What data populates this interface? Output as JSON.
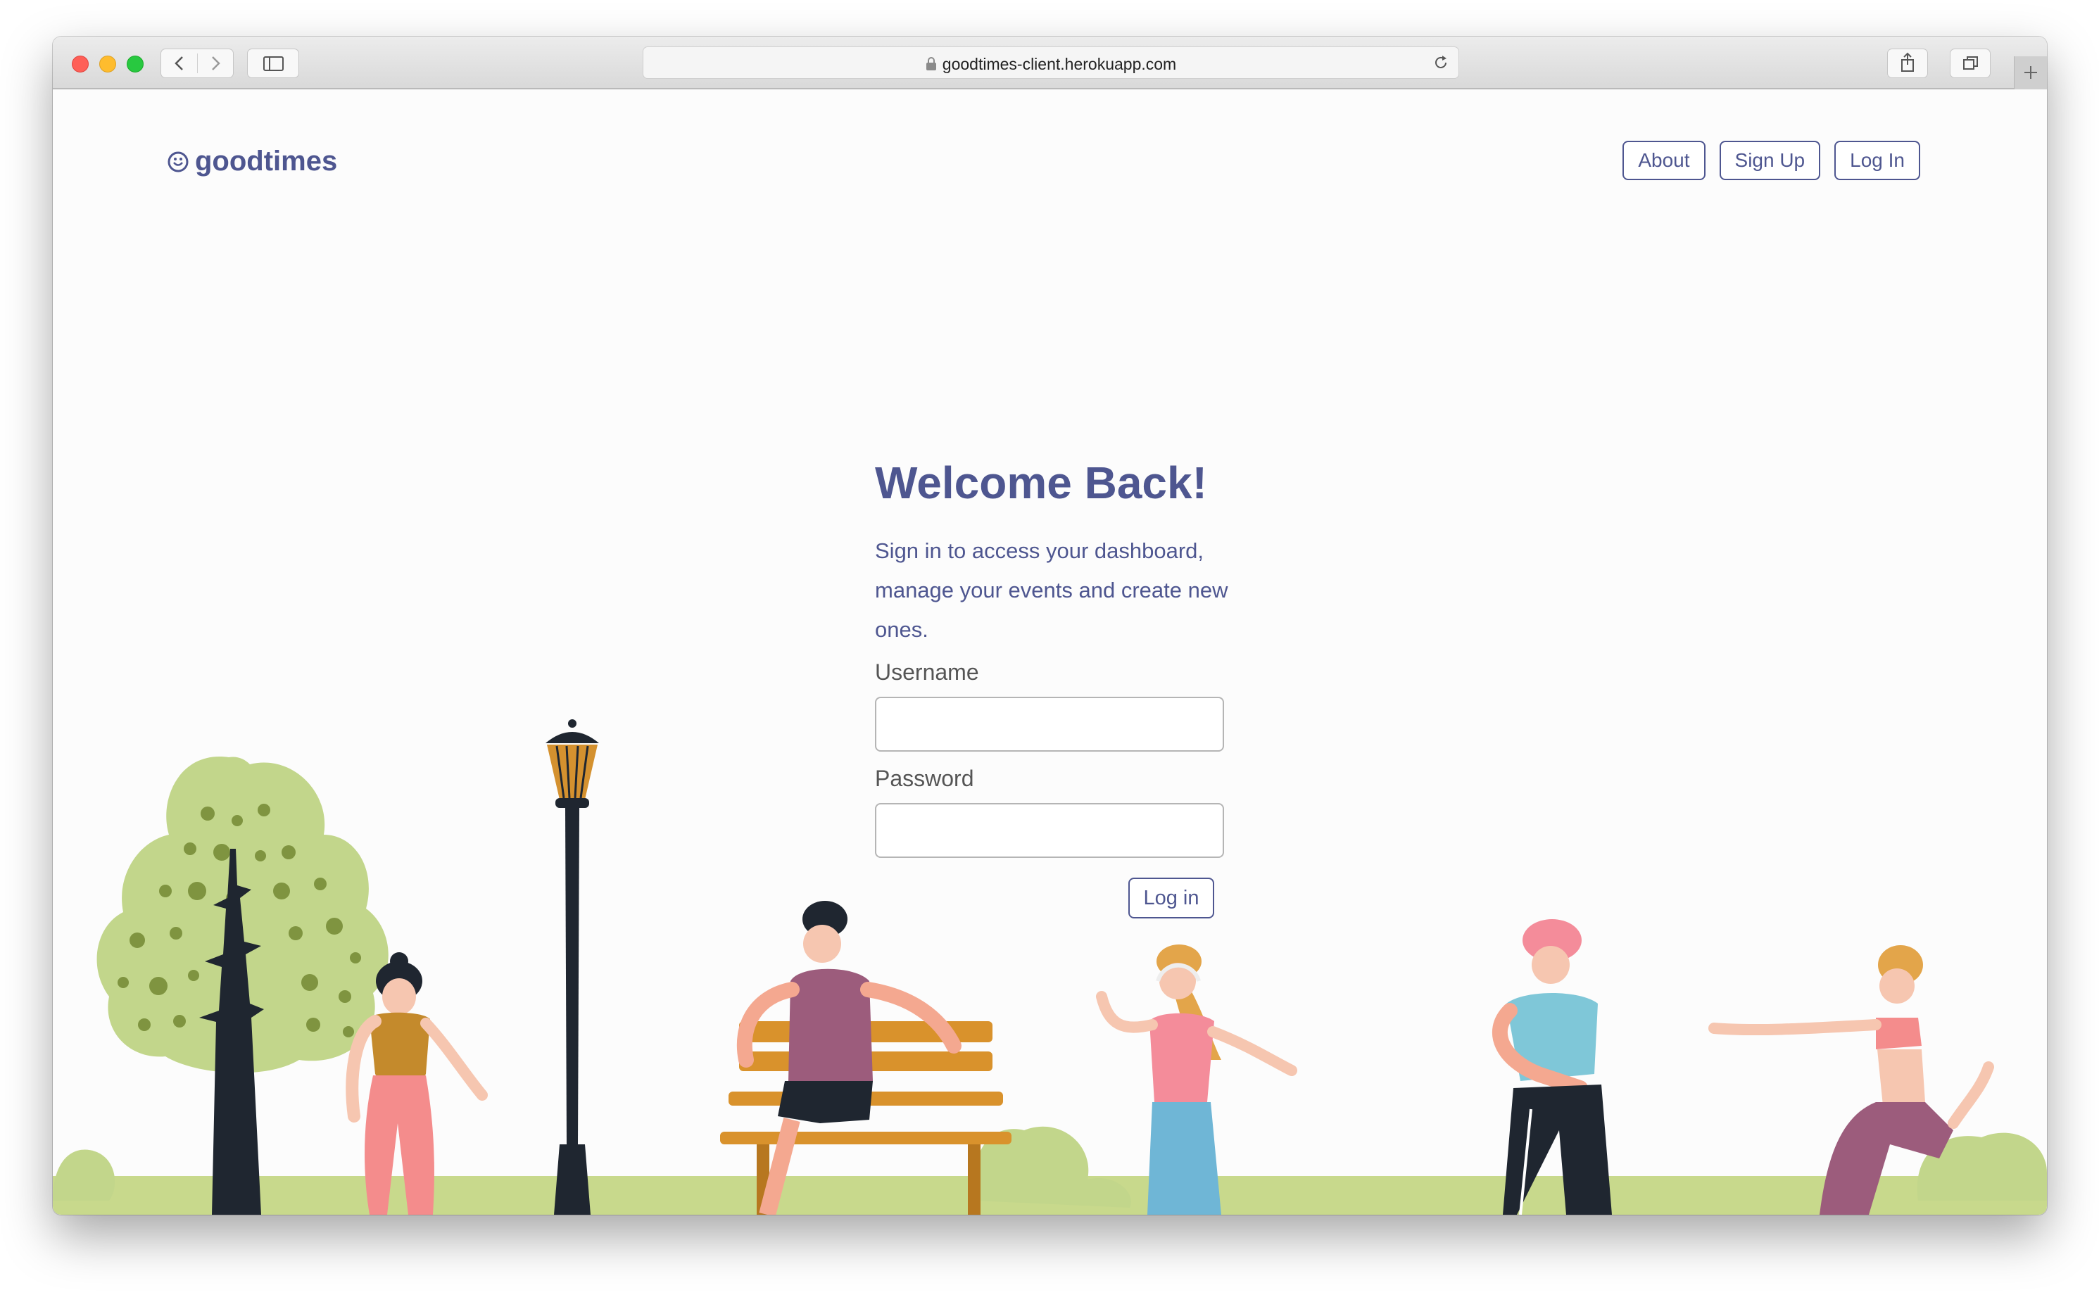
{
  "browser": {
    "url": "goodtimes-client.herokuapp.com"
  },
  "header": {
    "brand": "goodtimes",
    "nav": {
      "about": "About",
      "signup": "Sign Up",
      "login": "Log In"
    }
  },
  "login_form": {
    "title": "Welcome Back!",
    "subtitle": "Sign in to access your dashboard, manage your events and create new ones.",
    "username_label": "Username",
    "username_value": "",
    "password_label": "Password",
    "password_value": "",
    "submit_label": "Log in"
  },
  "colors": {
    "accent": "#4e5690",
    "grass": "#c8d98c",
    "tree": "#c2d68b"
  },
  "icons": {
    "brand": "smiley-icon",
    "lock": "lock-icon",
    "reload": "reload-icon"
  }
}
